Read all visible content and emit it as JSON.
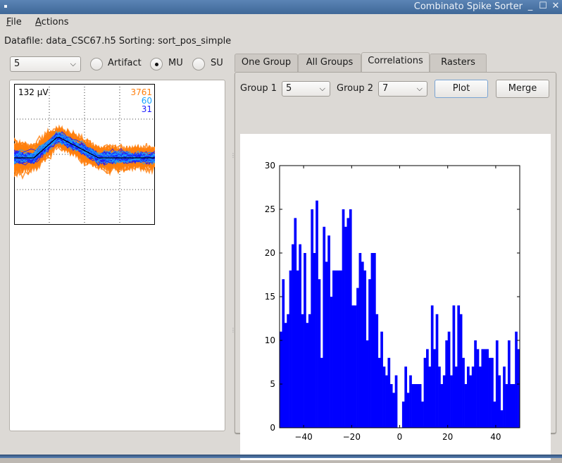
{
  "window": {
    "title": "Combinato Spike Sorter",
    "buttons": {
      "minimize": "_",
      "maximize": "☐",
      "close": "✕"
    }
  },
  "menubar": {
    "items": [
      {
        "label": "File",
        "mnemonic": "F",
        "rest": "ile"
      },
      {
        "label": "Actions",
        "mnemonic": "A",
        "rest": "ctions"
      }
    ]
  },
  "info": {
    "datafile_line": "Datafile: data_CSC67.h5 Sorting: sort_pos_simple"
  },
  "left": {
    "group_select": {
      "value": "5"
    },
    "radios": [
      {
        "label": "Artifact",
        "checked": false
      },
      {
        "label": "MU",
        "checked": true
      },
      {
        "label": "SU",
        "checked": false
      }
    ],
    "waveform_plot": {
      "amplitude_label": "132 µV",
      "counts": [
        {
          "value": "3761",
          "color": "#ff7f0e"
        },
        {
          "value": "60",
          "color": "#1aa3ff"
        },
        {
          "value": "31",
          "color": "#1a1aff"
        }
      ]
    }
  },
  "tabs": [
    {
      "label": "One Group",
      "active": false
    },
    {
      "label": "All Groups",
      "active": false
    },
    {
      "label": "Correlations",
      "active": true
    },
    {
      "label": "Rasters",
      "active": false
    }
  ],
  "correlations": {
    "group1_label": "Group 1",
    "group1_value": "5",
    "group2_label": "Group 2",
    "group2_value": "7",
    "plot_button": "Plot",
    "merge_button": "Merge"
  },
  "colors": {
    "bar": "#0000ff",
    "spikes_orange": "#ff7f0e",
    "spikes_blue": "#1a1aff",
    "title_bar": "#4a74a6"
  },
  "chart_data": {
    "type": "bar",
    "title": "",
    "xlabel": "",
    "ylabel": "",
    "xlim": [
      -50,
      50
    ],
    "ylim": [
      0,
      30
    ],
    "bin_width": 1,
    "x_ticks": [
      -40,
      -20,
      0,
      20,
      40
    ],
    "y_ticks": [
      0,
      5,
      10,
      15,
      20,
      25,
      30
    ],
    "x_tick_labels": [
      "−40",
      "−20",
      "0",
      "20",
      "40"
    ],
    "y_tick_labels": [
      "0",
      "5",
      "10",
      "15",
      "20",
      "25",
      "30"
    ],
    "grid": false,
    "bin_starts": [
      -50,
      -49,
      -48,
      -47,
      -46,
      -45,
      -44,
      -43,
      -42,
      -41,
      -40,
      -39,
      -38,
      -37,
      -36,
      -35,
      -34,
      -33,
      -32,
      -31,
      -30,
      -29,
      -28,
      -27,
      -26,
      -25,
      -24,
      -23,
      -22,
      -21,
      -20,
      -19,
      -18,
      -17,
      -16,
      -15,
      -14,
      -13,
      -12,
      -11,
      -10,
      -9,
      -8,
      -7,
      -6,
      -5,
      -4,
      -3,
      -2,
      -1,
      0,
      1,
      2,
      3,
      4,
      5,
      6,
      7,
      8,
      9,
      10,
      11,
      12,
      13,
      14,
      15,
      16,
      17,
      18,
      19,
      20,
      21,
      22,
      23,
      24,
      25,
      26,
      27,
      28,
      29,
      30,
      31,
      32,
      33,
      34,
      35,
      36,
      37,
      38,
      39,
      40,
      41,
      42,
      43,
      44,
      45,
      46,
      47,
      48,
      49
    ],
    "values": [
      11,
      17,
      12,
      13,
      18,
      21,
      24,
      18,
      21,
      13,
      20,
      12,
      13,
      25,
      20,
      26,
      17,
      8,
      23,
      19,
      22,
      15,
      18,
      18,
      18,
      18,
      25,
      23,
      24,
      25,
      14,
      14,
      16,
      20,
      19,
      18,
      10,
      17,
      20,
      20,
      13,
      8,
      11,
      7,
      6,
      8,
      5,
      4,
      6,
      0,
      0,
      3,
      7,
      4,
      6,
      5,
      5,
      5,
      5,
      3,
      8,
      9,
      7,
      14,
      9,
      13,
      7,
      5,
      6,
      10,
      11,
      6,
      14,
      7,
      14,
      13,
      8,
      5,
      7,
      6,
      7,
      10,
      9,
      7,
      9,
      9,
      9,
      8,
      8,
      3,
      10,
      6,
      2,
      7,
      5,
      10,
      5,
      5,
      11,
      9
    ]
  }
}
